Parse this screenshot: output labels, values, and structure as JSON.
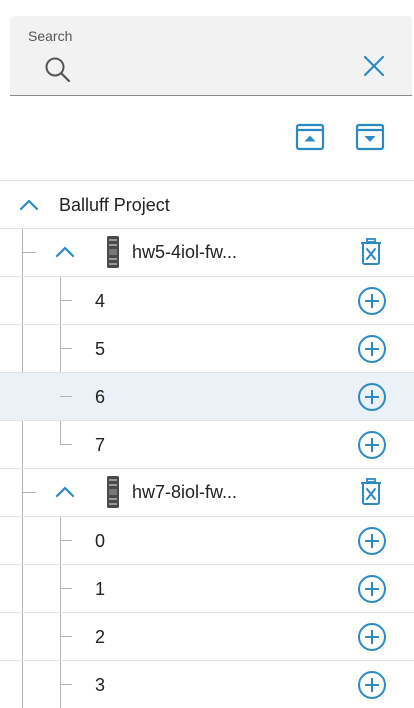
{
  "search": {
    "label": "Search",
    "value": "",
    "placeholder": ""
  },
  "toolbar": {
    "collapse_icon": "collapse-all-icon",
    "expand_icon": "expand-all-icon"
  },
  "colors": {
    "accent": "#2b8ac4",
    "selected_row": "#eaf2f8",
    "divider": "#e3e3e3",
    "tree_line": "#b3b3b3"
  },
  "tree": {
    "project": {
      "label": "Balluff Project",
      "expanded": true
    },
    "devices": [
      {
        "label": "hw5-4iol-fw...",
        "expanded": true,
        "ports": [
          "4",
          "5",
          "6",
          "7"
        ],
        "selected_port": "6"
      },
      {
        "label": "hw7-8iol-fw...",
        "expanded": true,
        "ports": [
          "0",
          "1",
          "2",
          "3"
        ]
      }
    ]
  }
}
